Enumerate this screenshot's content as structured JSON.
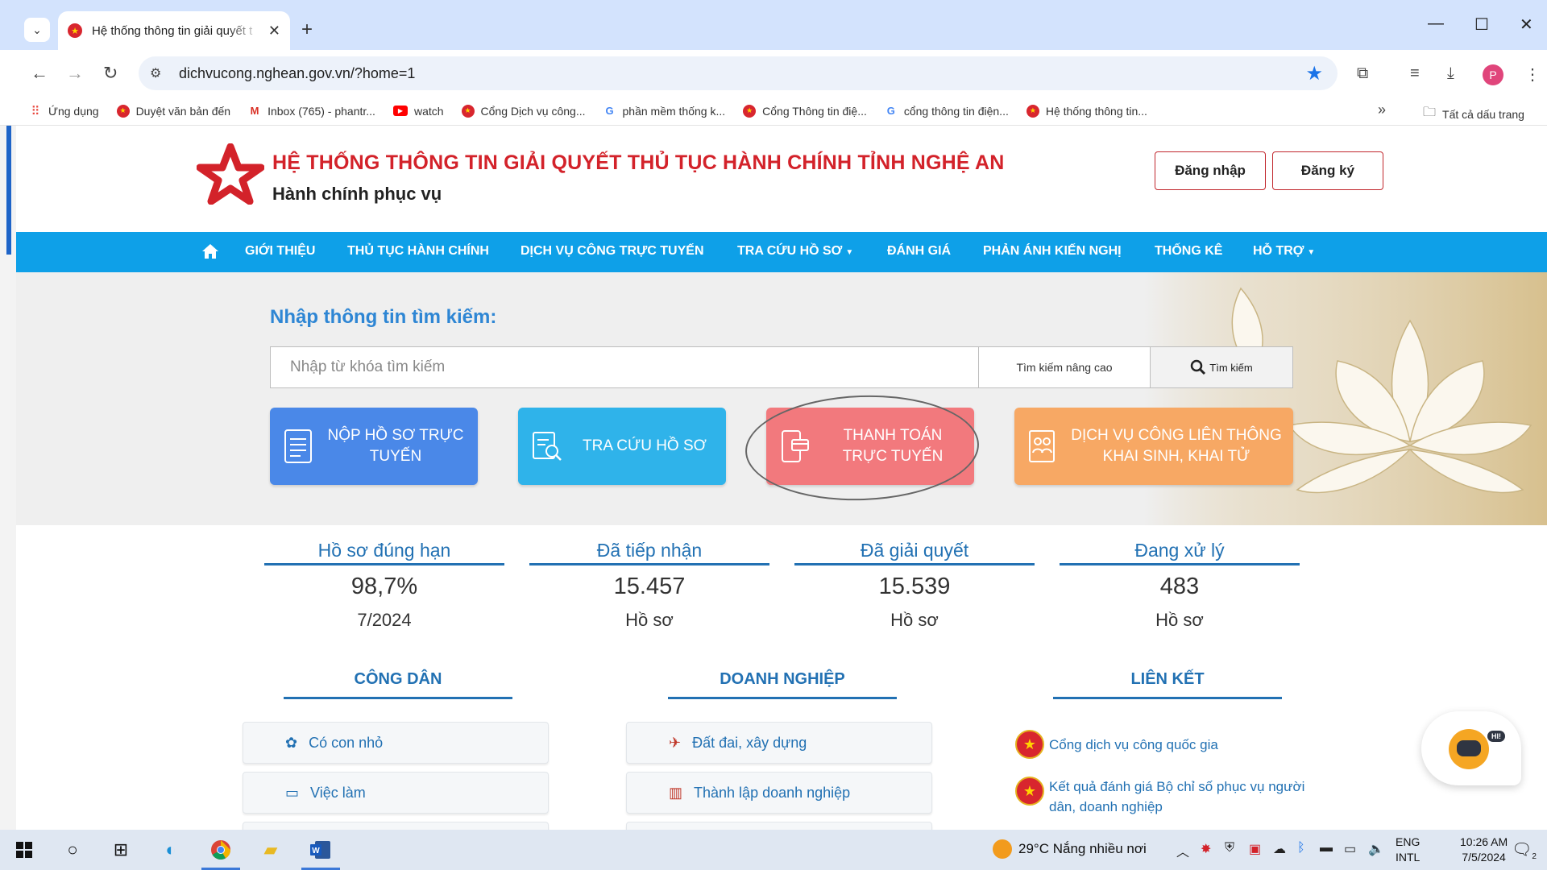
{
  "browser": {
    "tab_title": "Hệ thống thông tin giải quyết t",
    "url": "dichvucong.nghean.gov.vn/?home=1",
    "bookmarks": [
      {
        "label": "Ứng dụng",
        "icon": "apps-icon"
      },
      {
        "label": "Duyệt văn bản đến",
        "icon": "emblem-icon"
      },
      {
        "label": "Inbox (765) - phantr...",
        "icon": "gmail-icon"
      },
      {
        "label": "watch",
        "icon": "youtube-icon"
      },
      {
        "label": "Cổng Dịch vụ công...",
        "icon": "emblem-icon"
      },
      {
        "label": "phần mềm thống k...",
        "icon": "google-icon"
      },
      {
        "label": "Cổng Thông tin điệ...",
        "icon": "emblem-icon"
      },
      {
        "label": "cổng thông tin điện...",
        "icon": "google-icon"
      },
      {
        "label": "Hệ thống thông tin...",
        "icon": "emblem-icon"
      }
    ],
    "all_bookmarks": "Tất cả dấu trang",
    "more_bookmarks": "»",
    "profile_initial": "P"
  },
  "site": {
    "title": "HỆ THỐNG THÔNG TIN GIẢI QUYẾT THỦ TỤC HÀNH CHÍNH TỈNH NGHỆ AN",
    "subtitle": "Hành chính phục vụ",
    "login": "Đăng nhập",
    "register": "Đăng ký"
  },
  "nav": [
    {
      "label": "GIỚI THIỆU",
      "dropdown": false
    },
    {
      "label": "THỦ TỤC HÀNH CHÍNH",
      "dropdown": false
    },
    {
      "label": "DỊCH VỤ CÔNG TRỰC TUYẾN",
      "dropdown": false
    },
    {
      "label": "TRA CỨU HỒ SƠ",
      "dropdown": true
    },
    {
      "label": "ĐÁNH GIÁ",
      "dropdown": false
    },
    {
      "label": "PHẢN ÁNH KIẾN NGHỊ",
      "dropdown": false
    },
    {
      "label": "THỐNG KÊ",
      "dropdown": false
    },
    {
      "label": "HỖ TRỢ",
      "dropdown": true
    }
  ],
  "search": {
    "label": "Nhập thông tin tìm kiếm:",
    "placeholder": "Nhập từ khóa tìm kiếm",
    "advanced": "Tìm kiếm nâng cao",
    "button": "Tìm kiếm"
  },
  "services": [
    {
      "label": "NỘP HỒ SƠ TRỰC TUYẾN",
      "color": "#4a88e8"
    },
    {
      "label": "TRA CỨU HỒ SƠ",
      "color": "#2fb3ea"
    },
    {
      "label": "THANH TOÁN TRỰC TUYẾN",
      "color": "#f2797d"
    },
    {
      "label": "DỊCH VỤ CÔNG LIÊN THÔNG KHAI SINH, KHAI TỬ",
      "color": "#f7a864"
    }
  ],
  "stats": [
    {
      "label": "Hồ sơ đúng hạn",
      "value": "98,7%",
      "unit": "7/2024"
    },
    {
      "label": "Đã tiếp nhận",
      "value": "15.457",
      "unit": "Hồ sơ"
    },
    {
      "label": "Đã giải quyết",
      "value": "15.539",
      "unit": "Hồ sơ"
    },
    {
      "label": "Đang xử lý",
      "value": "483",
      "unit": "Hồ sơ"
    }
  ],
  "columns": {
    "citizen": {
      "title": "CÔNG DÂN",
      "items": [
        {
          "label": "Có con nhỏ",
          "icon": "baby-icon"
        },
        {
          "label": "Việc làm",
          "icon": "briefcase-icon"
        }
      ]
    },
    "business": {
      "title": "DOANH NGHIỆP",
      "items": [
        {
          "label": "Đất đai, xây dựng",
          "icon": "land-icon"
        },
        {
          "label": "Thành lập doanh nghiệp",
          "icon": "building-icon"
        }
      ]
    },
    "links": {
      "title": "LIÊN KẾT",
      "items": [
        {
          "label": "Cổng dịch vụ công quốc gia"
        },
        {
          "label_line1": "Kết quả đánh giá Bộ chỉ số phục vụ người",
          "label_line2": "dân, doanh nghiệp"
        }
      ]
    }
  },
  "chatbot": {
    "badge": "HI!"
  },
  "taskbar": {
    "weather": "29°C  Nắng nhiều nơi",
    "lang_line1": "ENG",
    "lang_line2": "INTL",
    "time": "10:26 AM",
    "date": "7/5/2024",
    "notif_count": "2"
  }
}
